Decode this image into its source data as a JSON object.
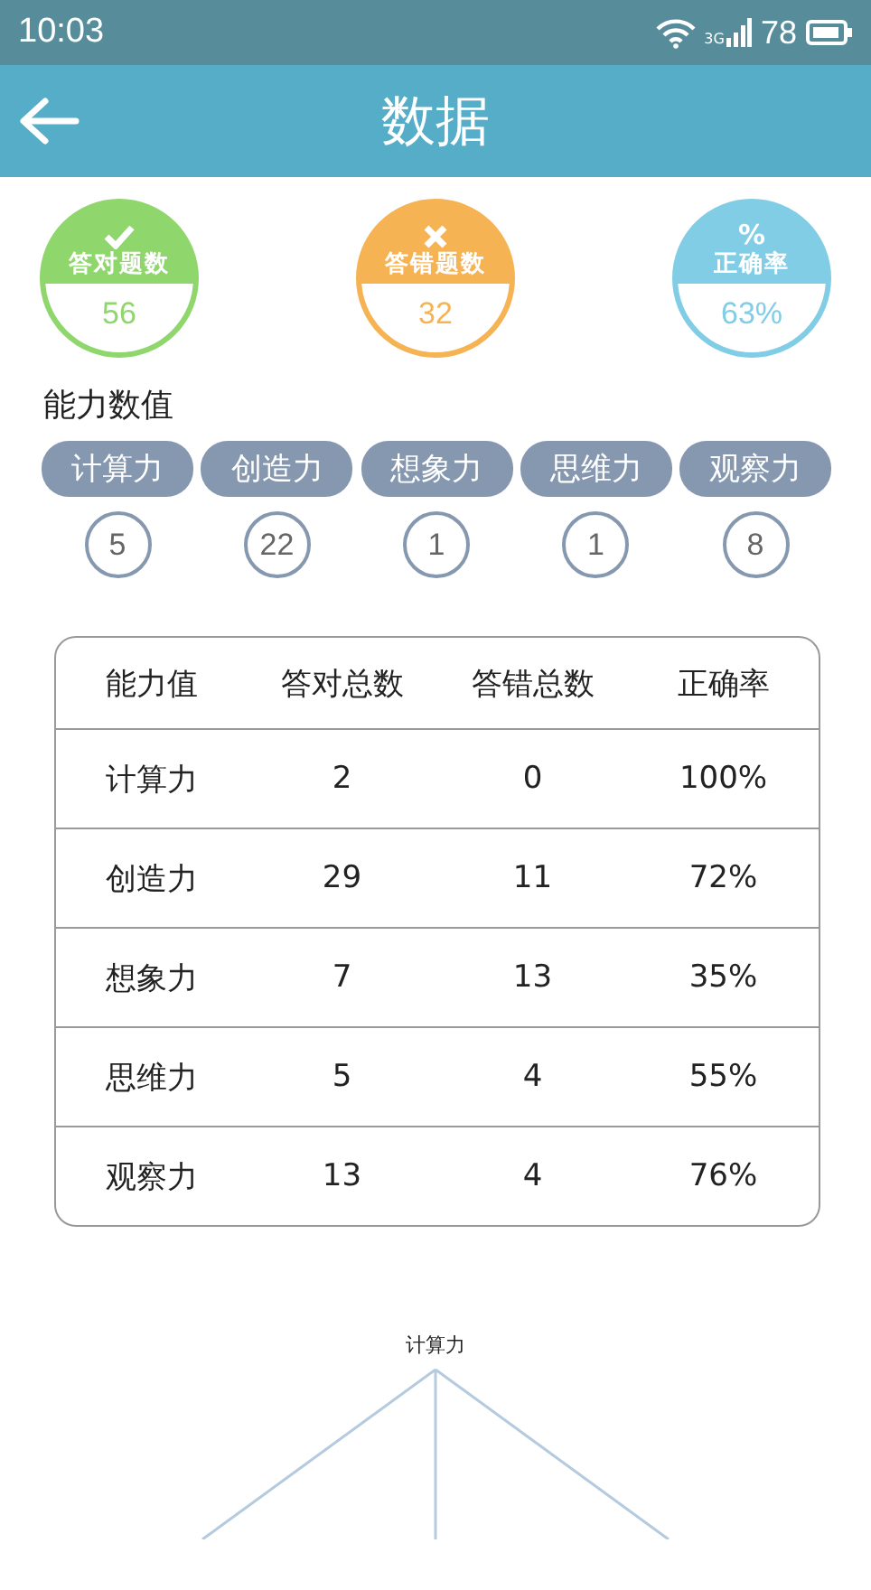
{
  "status_bar": {
    "time": "10:03",
    "network": "3G",
    "battery": "78"
  },
  "header": {
    "title": "数据"
  },
  "stats": [
    {
      "kind": "correct",
      "label": "答对题数",
      "value": "56",
      "color": "#8fd66c"
    },
    {
      "kind": "wrong",
      "label": "答错题数",
      "value": "32",
      "color": "#f6b354"
    },
    {
      "kind": "rate",
      "icon": "%",
      "label": "正确率",
      "value": "63%",
      "color": "#82cde6"
    }
  ],
  "abilities": {
    "title": "能力数值",
    "items": [
      {
        "name": "计算力",
        "value": "5"
      },
      {
        "name": "创造力",
        "value": "22"
      },
      {
        "name": "想象力",
        "value": "1"
      },
      {
        "name": "思维力",
        "value": "1"
      },
      {
        "name": "观察力",
        "value": "8"
      }
    ]
  },
  "table": {
    "columns": [
      "能力值",
      "答对总数",
      "答错总数",
      "正确率"
    ],
    "rows": [
      [
        "计算力",
        "2",
        "0",
        "100%"
      ],
      [
        "创造力",
        "29",
        "11",
        "72%"
      ],
      [
        "想象力",
        "7",
        "13",
        "35%"
      ],
      [
        "思维力",
        "5",
        "4",
        "55%"
      ],
      [
        "观察力",
        "13",
        "4",
        "76%"
      ]
    ]
  },
  "radar": {
    "top_label": "计算力"
  }
}
